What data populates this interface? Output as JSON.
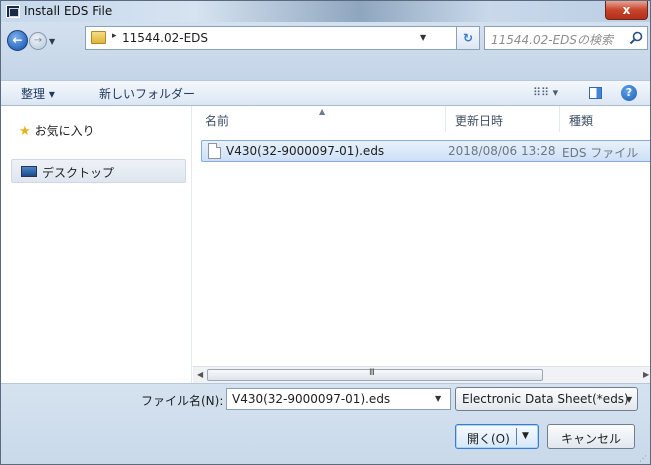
{
  "window": {
    "title": "Install EDS File",
    "close_label": "x"
  },
  "address_bar": {
    "separator": "▸",
    "path": "11544.02-EDS",
    "search_placeholder": "11544.02-EDSの検索"
  },
  "toolbar": {
    "organize_label": "整理 ▾",
    "new_folder_label": "新しいフォルダー",
    "view_label": "⠿⠿ ▾",
    "help_label": "?"
  },
  "nav_pane": {
    "favorites_label": "お気に入り",
    "desktop_label": "デスクトップ"
  },
  "file_list": {
    "columns": {
      "name": "名前",
      "date": "更新日時",
      "type": "種類"
    },
    "rows": [
      {
        "name": "V430(32-9000097-01).eds",
        "date": "2018/08/06 13:28",
        "type": "EDS ファイル"
      }
    ],
    "scroll_grip": "III"
  },
  "bottom": {
    "filename_label": "ファイル名(N):",
    "filename_value": "V430(32-9000097-01).eds",
    "filetype_value": "Electronic Data Sheet(*eds)",
    "open_label": "開く(O)",
    "cancel_label": "キャンセル"
  },
  "colors": {
    "selection_fill": "#cde0f7",
    "selection_border": "#84acdd",
    "close_button": "#c7442b",
    "frame": "#c3d3e5"
  },
  "icons": [
    "app-icon",
    "back-arrow-icon",
    "forward-arrow-icon",
    "folder-icon",
    "refresh-icon",
    "search-icon",
    "view-icon",
    "preview-pane-icon",
    "help-icon",
    "star-icon",
    "desktop-icon",
    "file-icon"
  ]
}
